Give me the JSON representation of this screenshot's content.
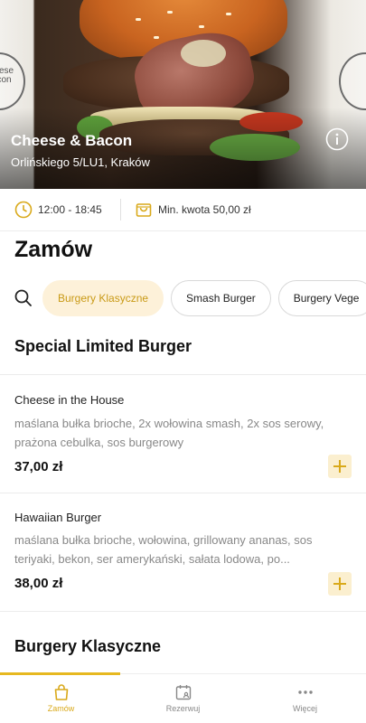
{
  "restaurant": {
    "name": "Cheese & Bacon",
    "address": "Orlińskiego 5/LU1, Kraków",
    "logo_text": "cheese bacon"
  },
  "info": {
    "hours": "12:00 - 18:45",
    "min_order": "Min. kwota 50,00 zł"
  },
  "page_title": "Zamów",
  "categories": [
    {
      "label": "Burgery Klasyczne",
      "active": true
    },
    {
      "label": "Smash Burger",
      "active": false
    },
    {
      "label": "Burgery Vege",
      "active": false
    }
  ],
  "sections": [
    {
      "title": "Special Limited Burger",
      "items": [
        {
          "name": "Cheese in the House",
          "description": "maślana bułka brioche, 2x wołowina smash, 2x sos serowy, prażona cebulka, sos burgerowy",
          "price": "37,00 zł"
        },
        {
          "name": "Hawaiian Burger",
          "description": "maślana bułka brioche, wołowina, grillowany ananas, sos teriyaki, bekon, ser amerykański, sałata lodowa, po...",
          "price": "38,00 zł"
        }
      ]
    },
    {
      "title": "Burgery Klasyczne",
      "items": []
    }
  ],
  "nav": [
    {
      "label": "Zamów",
      "icon": "bag-icon",
      "active": true
    },
    {
      "label": "Rezerwuj",
      "icon": "calendar-icon",
      "active": false
    },
    {
      "label": "Więcej",
      "icon": "more-icon",
      "active": false
    }
  ],
  "colors": {
    "accent": "#d9a91a",
    "accent_bg": "#fdf1d9"
  }
}
